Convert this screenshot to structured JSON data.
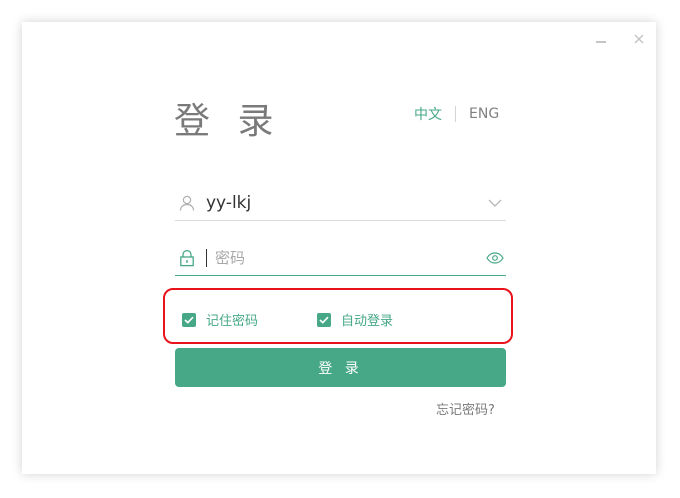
{
  "window": {
    "title": "登 录",
    "minimize_icon": "minimize-icon",
    "close_icon": "close-icon"
  },
  "language": {
    "options": [
      "中文",
      "ENG"
    ],
    "selected": "中文"
  },
  "username": {
    "value": "yy-lkj",
    "icon": "user-icon",
    "dropdown_icon": "chevron-down-icon"
  },
  "password": {
    "value": "",
    "placeholder": "密码",
    "icon": "lock-icon",
    "toggle_icon": "eye-icon"
  },
  "options": {
    "remember_password": {
      "label": "记住密码",
      "checked": true
    },
    "auto_login": {
      "label": "自动登录",
      "checked": true
    }
  },
  "login_button": "登 录",
  "forgot_password": "忘记密码?",
  "colors": {
    "accent": "#46a886",
    "highlight_border": "#e8131b",
    "title_text": "#7a7a7a"
  }
}
